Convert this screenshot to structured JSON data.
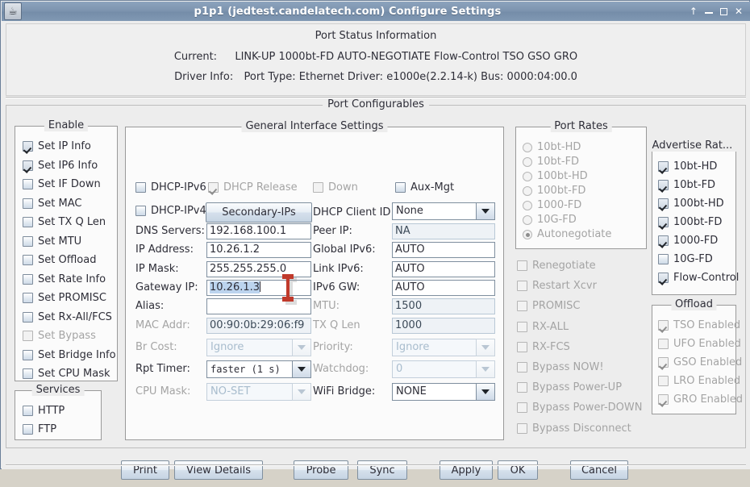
{
  "window": {
    "title": "p1p1 (jedtest.candelatech.com) Configure Settings",
    "icon": "java-coffee-cup-icon",
    "controls": {
      "shade": "↑",
      "minimize": "_",
      "maximize": "□",
      "close": "✕"
    }
  },
  "status": {
    "title": "Port Status Information",
    "current_label": "Current:",
    "current_value": "LINK-UP 1000bt-FD AUTO-NEGOTIATE Flow-Control TSO GSO GRO",
    "driver_label": "Driver Info:",
    "driver_value": "Port Type: Ethernet   Driver: e1000e(2.2.14-k)  Bus: 0000:04:00.0"
  },
  "port_configurables": {
    "legend": "Port Configurables"
  },
  "enable": {
    "legend": "Enable",
    "items": [
      {
        "label": "Set IP Info",
        "checked": true,
        "disabled": false
      },
      {
        "label": "Set IP6 Info",
        "checked": true,
        "disabled": false
      },
      {
        "label": "Set IF Down",
        "checked": false,
        "disabled": false
      },
      {
        "label": "Set MAC",
        "checked": false,
        "disabled": false
      },
      {
        "label": "Set TX Q Len",
        "checked": false,
        "disabled": false
      },
      {
        "label": "Set MTU",
        "checked": false,
        "disabled": false
      },
      {
        "label": "Set Offload",
        "checked": false,
        "disabled": false
      },
      {
        "label": "Set Rate Info",
        "checked": false,
        "disabled": false
      },
      {
        "label": "Set PROMISC",
        "checked": false,
        "disabled": false
      },
      {
        "label": "Set Rx-All/FCS",
        "checked": false,
        "disabled": false
      },
      {
        "label": "Set Bypass",
        "checked": false,
        "disabled": true
      },
      {
        "label": "Set Bridge Info",
        "checked": false,
        "disabled": false
      },
      {
        "label": "Set CPU Mask",
        "checked": false,
        "disabled": false
      }
    ]
  },
  "services": {
    "legend": "Services",
    "items": [
      {
        "label": "HTTP",
        "checked": false,
        "disabled": false
      },
      {
        "label": "FTP",
        "checked": false,
        "disabled": false
      }
    ]
  },
  "general": {
    "legend": "General Interface Settings",
    "checks": [
      {
        "label": "DHCP-IPv6",
        "checked": false,
        "disabled": false
      },
      {
        "label": "DHCP Release",
        "checked": true,
        "disabled": true
      },
      {
        "label": "Down",
        "checked": false,
        "disabled": true
      },
      {
        "label": "Aux-Mgt",
        "checked": false,
        "disabled": false
      },
      {
        "label": "DHCP-IPv4",
        "checked": false,
        "disabled": false
      }
    ],
    "secondary_ips_button": "Secondary-IPs",
    "left_fields": [
      {
        "label": "DNS Servers:",
        "value": "192.168.100.1",
        "disabled": false,
        "readonly": false
      },
      {
        "label": "IP Address:",
        "value": "10.26.1.2",
        "disabled": false,
        "readonly": false
      },
      {
        "label": "IP Mask:",
        "value": "255.255.255.0",
        "disabled": false,
        "readonly": false
      },
      {
        "label": "Gateway IP:",
        "value": "10.26.1.3",
        "disabled": false,
        "readonly": false,
        "selected": true,
        "focused": true
      },
      {
        "label": "Alias:",
        "value": "",
        "disabled": false,
        "readonly": false
      },
      {
        "label": "MAC Addr:",
        "value": "00:90:0b:29:06:f9",
        "disabled": true,
        "readonly": true
      }
    ],
    "left_combos": [
      {
        "label": "Br Cost:",
        "value": "Ignore",
        "disabled": true,
        "mono": false
      },
      {
        "label": "Rpt Timer:",
        "value": "faster  (1 s)",
        "disabled": false,
        "mono": true
      },
      {
        "label": "CPU Mask:",
        "value": "NO-SET",
        "disabled": true,
        "mono": false
      }
    ],
    "right_top_combo": {
      "label": "DHCP Client ID:",
      "value": "None",
      "disabled": false
    },
    "right_fields": [
      {
        "label": "Peer IP:",
        "value": "NA",
        "disabled": false,
        "readonly": true
      },
      {
        "label": "Global IPv6:",
        "value": "AUTO",
        "disabled": false,
        "readonly": false
      },
      {
        "label": "Link IPv6:",
        "value": "AUTO",
        "disabled": false,
        "readonly": false
      },
      {
        "label": "IPv6 GW:",
        "value": "AUTO",
        "disabled": false,
        "readonly": false
      },
      {
        "label": "MTU:",
        "value": "1500",
        "disabled": true,
        "readonly": true
      },
      {
        "label": "TX Q Len",
        "value": "1000",
        "disabled": true,
        "readonly": true
      }
    ],
    "right_combos": [
      {
        "label": "Priority:",
        "value": "Ignore",
        "disabled": true
      },
      {
        "label": "Watchdog:",
        "value": "0",
        "disabled": true
      },
      {
        "label": "WiFi Bridge:",
        "value": "NONE",
        "disabled": false
      }
    ]
  },
  "port_rates": {
    "legend": "Port Rates",
    "items": [
      {
        "label": "10bt-HD",
        "selected": false,
        "disabled": true
      },
      {
        "label": "10bt-FD",
        "selected": false,
        "disabled": true
      },
      {
        "label": "100bt-HD",
        "selected": false,
        "disabled": true
      },
      {
        "label": "100bt-FD",
        "selected": false,
        "disabled": true
      },
      {
        "label": "1000-FD",
        "selected": false,
        "disabled": true
      },
      {
        "label": "10G-FD",
        "selected": false,
        "disabled": true
      },
      {
        "label": "Autonegotiate",
        "selected": true,
        "disabled": true
      }
    ]
  },
  "flags": {
    "items": [
      {
        "label": "Renegotiate",
        "checked": false,
        "disabled": true
      },
      {
        "label": "Restart Xcvr",
        "checked": false,
        "disabled": true
      },
      {
        "label": "PROMISC",
        "checked": false,
        "disabled": true
      },
      {
        "label": "RX-ALL",
        "checked": false,
        "disabled": true
      },
      {
        "label": "RX-FCS",
        "checked": false,
        "disabled": true
      },
      {
        "label": "Bypass NOW!",
        "checked": false,
        "disabled": true
      },
      {
        "label": "Bypass Power-UP",
        "checked": false,
        "disabled": true
      },
      {
        "label": "Bypass Power-DOWN",
        "checked": false,
        "disabled": true
      },
      {
        "label": "Bypass Disconnect",
        "checked": false,
        "disabled": true
      }
    ]
  },
  "advertise_rates": {
    "legend": "Advertise Rat...",
    "items": [
      {
        "label": "10bt-HD",
        "checked": true,
        "disabled": false
      },
      {
        "label": "10bt-FD",
        "checked": true,
        "disabled": false
      },
      {
        "label": "100bt-HD",
        "checked": true,
        "disabled": false
      },
      {
        "label": "100bt-FD",
        "checked": true,
        "disabled": false
      },
      {
        "label": "1000-FD",
        "checked": true,
        "disabled": false
      },
      {
        "label": "10G-FD",
        "checked": false,
        "disabled": false
      },
      {
        "label": "Flow-Control",
        "checked": true,
        "disabled": false
      }
    ]
  },
  "offload": {
    "legend": "Offload",
    "items": [
      {
        "label": "TSO Enabled",
        "checked": true,
        "disabled": true
      },
      {
        "label": "UFO Enabled",
        "checked": false,
        "disabled": true
      },
      {
        "label": "GSO Enabled",
        "checked": true,
        "disabled": true
      },
      {
        "label": "LRO Enabled",
        "checked": false,
        "disabled": true
      },
      {
        "label": "GRO Enabled",
        "checked": true,
        "disabled": true
      }
    ]
  },
  "buttons": [
    {
      "name": "print",
      "label": "Print"
    },
    {
      "name": "view-details",
      "label": "View Details"
    },
    {
      "name": "probe",
      "label": "Probe"
    },
    {
      "name": "sync",
      "label": "Sync"
    },
    {
      "name": "apply",
      "label": "Apply"
    },
    {
      "name": "ok",
      "label": "OK"
    },
    {
      "name": "cancel",
      "label": "Cancel"
    }
  ],
  "colors": {
    "titlebar": "#7e95b0",
    "background": "#ededed",
    "selection": "#bcd4ee",
    "cursor": "#c0392b"
  }
}
